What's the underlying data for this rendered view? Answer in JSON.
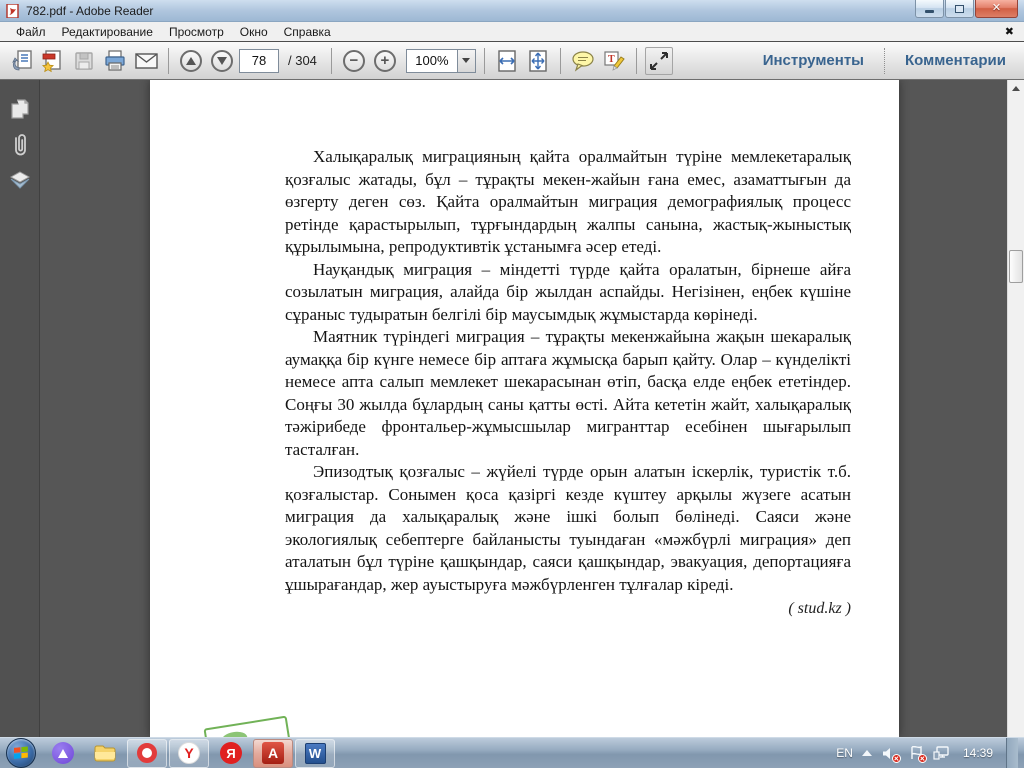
{
  "window": {
    "title": "782.pdf - Adobe Reader"
  },
  "menu": {
    "items": [
      "Файл",
      "Редактирование",
      "Просмотр",
      "Окно",
      "Справка"
    ]
  },
  "icons": {
    "close": "✕",
    "menu_close": "✖",
    "zoom_out": "−",
    "zoom_in": "+",
    "adobe_glyph": "A",
    "word_glyph": "W",
    "yandex_browser_glyph": "Y",
    "yandex_glyph": "Я"
  },
  "toolbar": {
    "page_current": "78",
    "page_total": "/ 304",
    "zoom_level": "100%",
    "tools_label": "Инструменты",
    "comments_label": "Комментарии"
  },
  "document": {
    "paragraphs": [
      "Халықаралық миграцияның қайта оралмайтын түріне мемлекетаралық қозғалыс жатады, бұл – тұрақты мекен-жайын ғана емес, азаматтығын да өзгерту деген сөз. Қайта оралмайтын миграция демографиялық процесс ретінде қарастырылып, тұрғындардың жалпы санына, жастық-жыныстық құрылымына, репродуктивтік ұстанымға әсер етеді.",
      "Науқандық миграция – міндетті түрде қайта оралатын, бірнеше айға созылатын миграция, алайда бір жылдан аспайды. Негізінен, еңбек күшіне сұраныс тудыратын белгілі бір маусымдық жұмыстарда көрінеді.",
      "Маятник түріндегі миграция – тұрақты мекенжайына жақын шекаралық аумаққа бір күнге немесе бір аптаға жұмысқа барып қайту. Олар – күнделікті немесе апта салып мемлекет шекарасынан өтіп, басқа елде еңбек ететіндер. Соңғы 30 жылда бұлардың саны қатты өсті. Айта кететін жайт, халықаралық тәжірибеде фронтальер-жұмысшылар мигранттар есебінен шығарылып тасталған.",
      "Эпизодтық қозғалыс – жүйелі түрде орын алатын іскерлік, туристік т.б. қозғалыстар. Сонымен қоса қазіргі кезде күштеу арқылы жүзеге асатын миграция да халықаралық және ішкі болып бөлінеді. Саяси және экологиялық себептерге байланысты туындаған «мәжбүрлі миграция» деп аталатын бұл түріне қашқындар, саяси қашқындар, эвакуация, депортацияға ұшырағандар, жер ауыстыруға мәжбүрленген тұлғалар кіреді."
    ],
    "attribution": "( stud.kz )"
  },
  "taskbar": {
    "language": "EN",
    "time": "14:39"
  }
}
